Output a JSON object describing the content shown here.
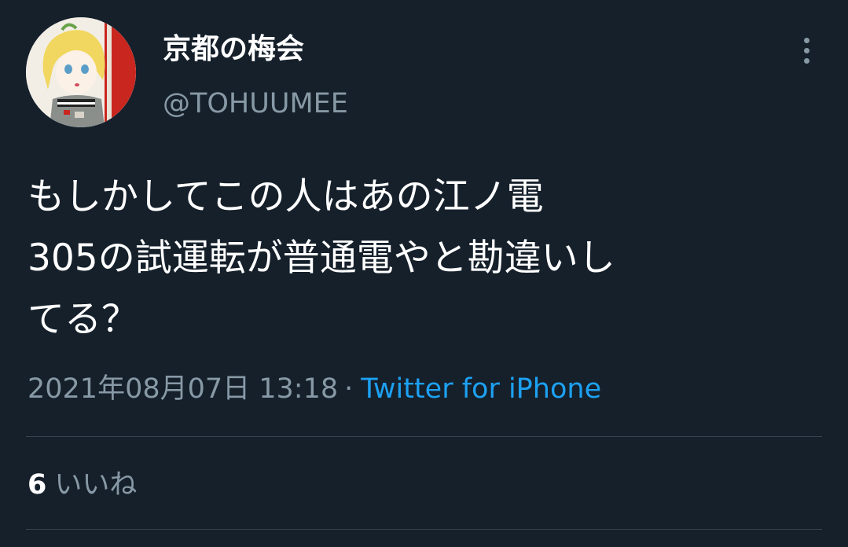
{
  "user": {
    "display_name": "京都の梅会",
    "handle": "@TOHUUMEE"
  },
  "tweet": {
    "text_lines": [
      "もしかしてこの人はあの江ノ電",
      "305の試運転が普通電やと勘違いし",
      "てる？"
    ],
    "timestamp": "2021年08月07日 13:18",
    "separator": "·",
    "source": "Twitter for iPhone"
  },
  "stats": {
    "likes_count": "6",
    "likes_label": "いいね"
  },
  "icons": {
    "more": "more-vertical-icon",
    "avatar": "anime-character-avatar"
  },
  "colors": {
    "background": "#15202b",
    "text": "#ffffff",
    "secondary_text": "#8899a6",
    "link": "#1da1f2",
    "divider": "#38444d"
  }
}
